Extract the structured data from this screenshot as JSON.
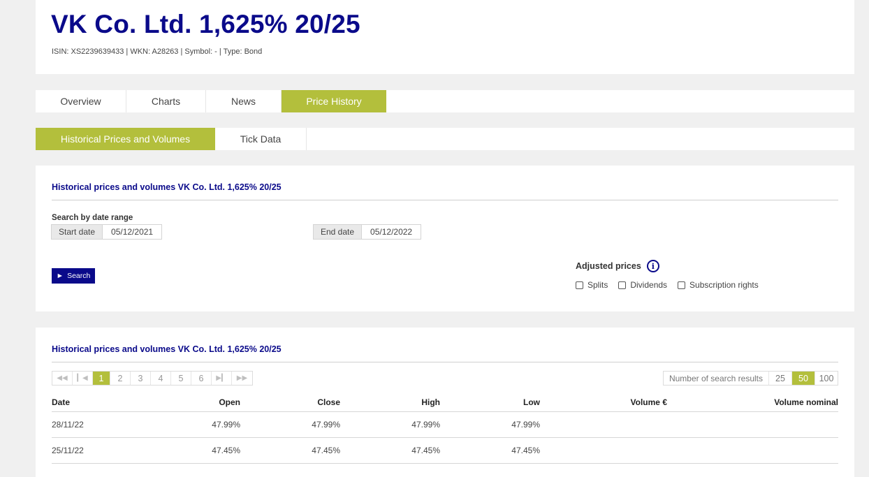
{
  "header": {
    "title": "VK Co. Ltd. 1,625% 20/25",
    "meta": "ISIN: XS2239639433 | WKN: A28263 | Symbol: - | Type: Bond"
  },
  "main_tabs": [
    "Overview",
    "Charts",
    "News",
    "Price History"
  ],
  "sub_tabs": [
    "Historical Prices and Volumes",
    "Tick Data"
  ],
  "search_panel": {
    "title": "Historical prices and volumes VK Co. Ltd. 1,625% 20/25",
    "range_label": "Search by date range",
    "start_label": "Start date",
    "start_value": "05/12/2021",
    "end_label": "End date",
    "end_value": "05/12/2022",
    "search_button": "Search",
    "adjusted_label": "Adjusted prices",
    "checkboxes": [
      "Splits",
      "Dividends",
      "Subscription rights"
    ]
  },
  "results_panel": {
    "title": "Historical prices and volumes VK Co. Ltd. 1,625% 20/25",
    "pages": [
      "1",
      "2",
      "3",
      "4",
      "5",
      "6"
    ],
    "current_page": "1",
    "results_label": "Number of search results",
    "results_options": [
      "25",
      "50",
      "100"
    ],
    "results_selected": "50",
    "columns": [
      "Date",
      "Open",
      "Close",
      "High",
      "Low",
      "Volume €",
      "Volume nominal"
    ],
    "rows": [
      [
        "28/11/22",
        "47.99%",
        "47.99%",
        "47.99%",
        "47.99%",
        "",
        ""
      ],
      [
        "25/11/22",
        "47.45%",
        "47.45%",
        "47.45%",
        "47.45%",
        "",
        ""
      ]
    ]
  },
  "colors": {
    "brand_blue": "#0a0a8a",
    "accent_green": "#b3bf3c",
    "background": "#f0f0f0"
  }
}
